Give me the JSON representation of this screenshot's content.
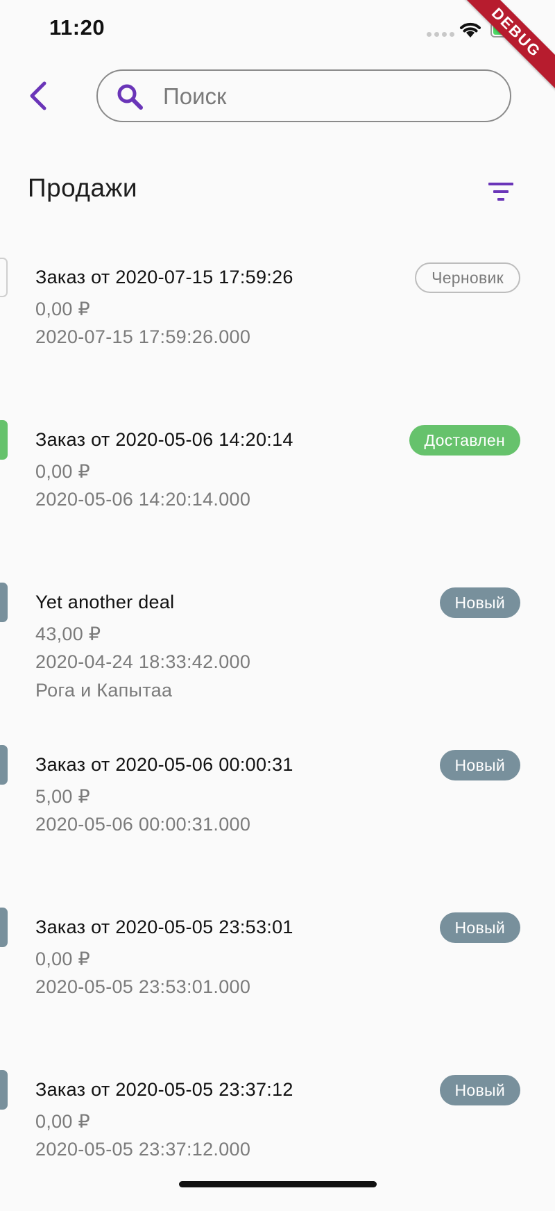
{
  "status_bar": {
    "time": "11:20"
  },
  "debug_banner": "DEBUG",
  "search": {
    "placeholder": "Поиск",
    "value": ""
  },
  "header": {
    "title": "Продажи"
  },
  "colors": {
    "accent": "#6a35b8",
    "green": "#66c26c",
    "grey_badge": "#78909c"
  },
  "orders": [
    {
      "title": "Заказ от 2020-07-15 17:59:26",
      "amount": "0,00 ₽",
      "timestamp": "2020-07-15 17:59:26.000",
      "status": "Черновик",
      "status_kind": "draft"
    },
    {
      "title": "Заказ от 2020-05-06 14:20:14",
      "amount": "0,00 ₽",
      "timestamp": "2020-05-06 14:20:14.000",
      "status": "Доставлен",
      "status_kind": "delivered"
    },
    {
      "title": "Yet another deal",
      "amount": "43,00 ₽",
      "timestamp": "2020-04-24 18:33:42.000",
      "client": "Рога и Капытаа",
      "status": "Новый",
      "status_kind": "new"
    },
    {
      "title": "Заказ от 2020-05-06 00:00:31",
      "amount": "5,00 ₽",
      "timestamp": "2020-05-06 00:00:31.000",
      "status": "Новый",
      "status_kind": "new"
    },
    {
      "title": "Заказ от 2020-05-05 23:53:01",
      "amount": "0,00 ₽",
      "timestamp": "2020-05-05 23:53:01.000",
      "status": "Новый",
      "status_kind": "new"
    },
    {
      "title": "Заказ от 2020-05-05 23:37:12",
      "amount": "0,00 ₽",
      "timestamp": "2020-05-05 23:37:12.000",
      "status": "Новый",
      "status_kind": "new"
    }
  ]
}
